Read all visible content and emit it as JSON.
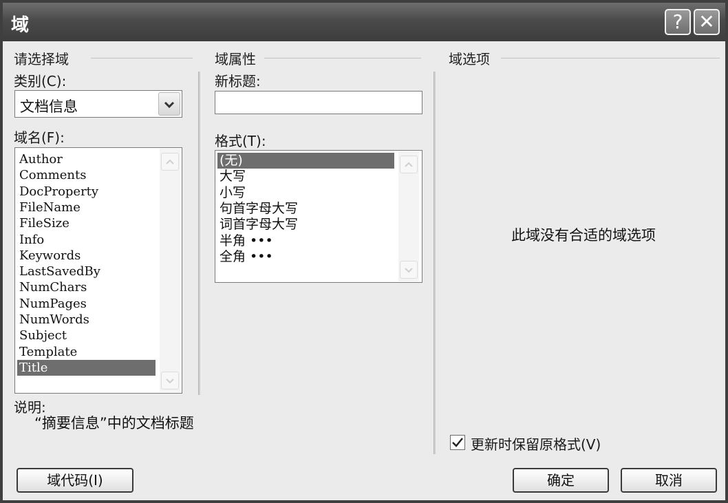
{
  "dialog": {
    "title": "域",
    "help_glyph": "?",
    "close_glyph": "✕"
  },
  "select_field": {
    "header": "请选择域",
    "category_label": "类别(C):",
    "category_value": "文档信息",
    "field_names_label": "域名(F):",
    "field_names": [
      "Author",
      "Comments",
      "DocProperty",
      "FileName",
      "FileSize",
      "Info",
      "Keywords",
      "LastSavedBy",
      "NumChars",
      "NumPages",
      "NumWords",
      "Subject",
      "Template",
      "Title"
    ],
    "selected_field": "Title",
    "description_label": "说明:",
    "description_text": "“摘要信息”中的文档标题"
  },
  "field_properties": {
    "header": "域属性",
    "new_title_label": "新标题:",
    "new_title_value": "",
    "format_label": "格式(T):",
    "formats": [
      "(无)",
      "大写",
      "小写",
      "句首字母大写",
      "词首字母大写",
      "半角 •••",
      "全角 •••"
    ],
    "selected_format": "(无)"
  },
  "field_options": {
    "header": "域选项",
    "empty_message": "此域没有合适的域选项",
    "preserve_format_label": "更新时保留原格式(V)",
    "preserve_format_checked": true
  },
  "buttons": {
    "field_codes": "域代码(I)",
    "ok": "确定",
    "cancel": "取消"
  },
  "colors": {
    "selection": "#6e6e6e",
    "titlebar": "#4a4a4a"
  }
}
